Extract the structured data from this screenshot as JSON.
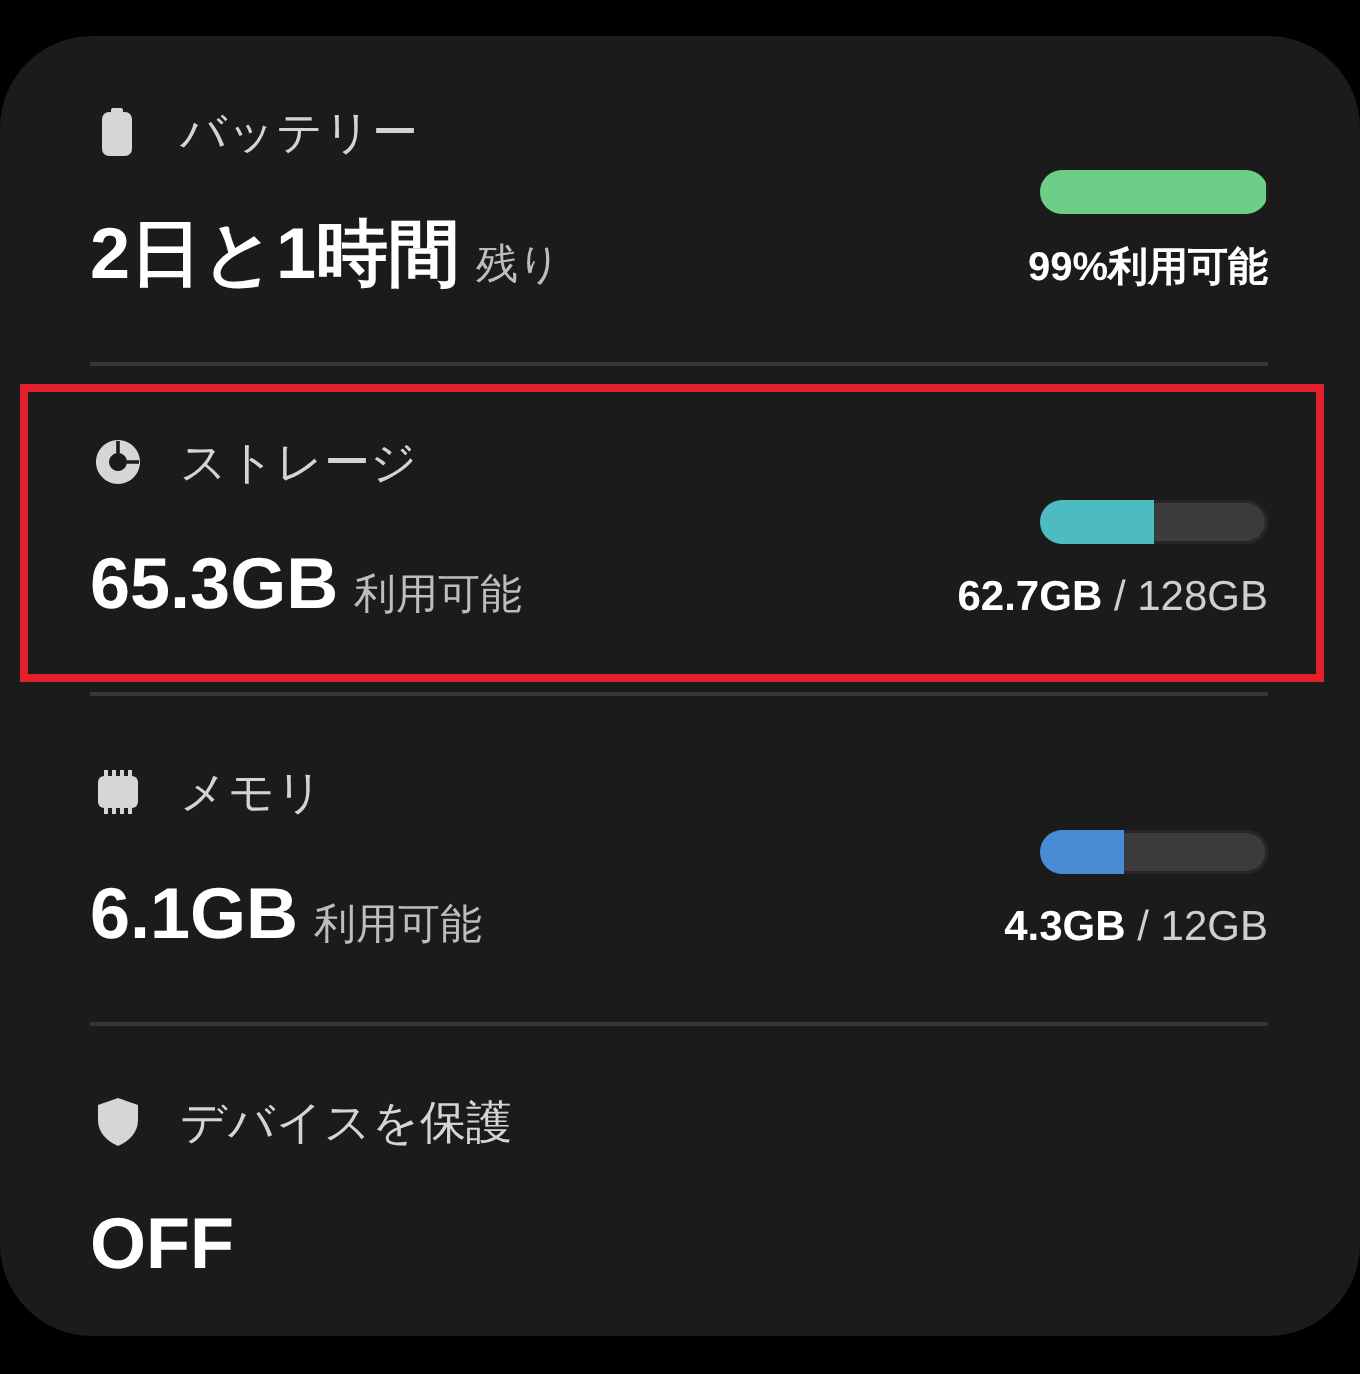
{
  "sections": [
    {
      "kind": "battery",
      "title": "バッテリー",
      "value": "2日と1時間",
      "note": "残り",
      "highlighted": false,
      "meter": {
        "level": 0.99,
        "color": "#6dcf87",
        "reading": "99%利用可能"
      }
    },
    {
      "kind": "storage",
      "title": "ストレージ",
      "value": "65.3GB",
      "note": "利用可能",
      "highlighted": true,
      "meter": {
        "level": 0.5,
        "color": "#4dbcc2",
        "reading": "**62.7GB** / 128GB"
      }
    },
    {
      "kind": "memory",
      "title": "メモリ",
      "value": "6.1GB",
      "note": "利用可能",
      "highlighted": false,
      "meter": {
        "level": 0.37,
        "color": "#4a8bd6",
        "reading": "**4.3GB** / 12GB"
      }
    },
    {
      "kind": "protection",
      "title": "デバイスを保護",
      "value": "OFF",
      "highlighted": false
    }
  ]
}
